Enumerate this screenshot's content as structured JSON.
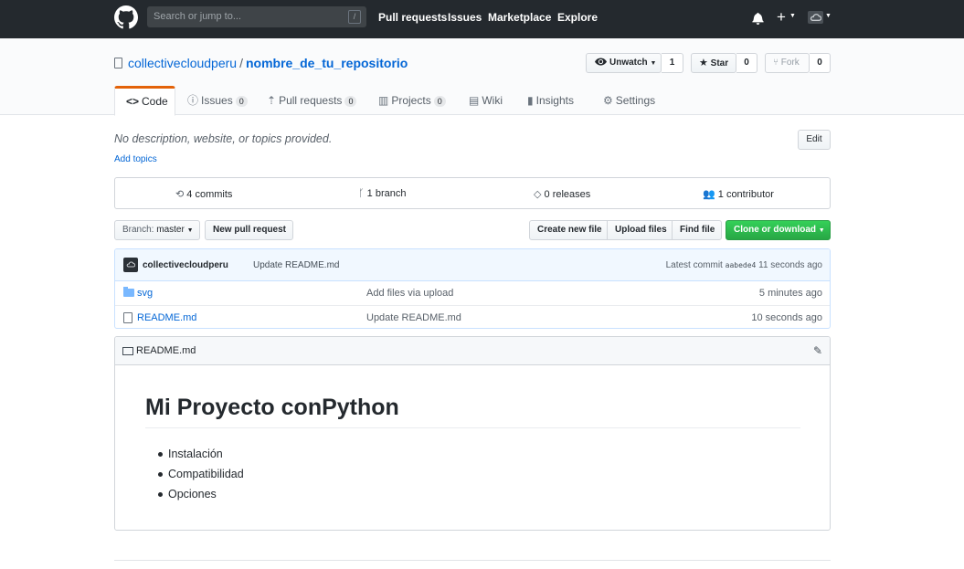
{
  "topbar": {
    "search_placeholder": "Search or jump to...",
    "search_shortcut": "/",
    "nav": [
      "Pull requests",
      "Issues",
      "Marketplace",
      "Explore"
    ]
  },
  "repo": {
    "owner": "collectivecloudperu",
    "separator": "/",
    "name": "nombre_de_tu_repositorio",
    "watch_label": "Unwatch",
    "watch_count": "1",
    "star_label": "Star",
    "star_count": "0",
    "fork_label": "Fork",
    "fork_count": "0"
  },
  "tabs": [
    {
      "label": "Code",
      "icon": "code-icon",
      "count": ""
    },
    {
      "label": "Issues",
      "icon": "issue-icon",
      "count": "0"
    },
    {
      "label": "Pull requests",
      "icon": "pull-request-icon",
      "count": "0"
    },
    {
      "label": "Projects",
      "icon": "project-icon",
      "count": "0"
    },
    {
      "label": "Wiki",
      "icon": "wiki-icon",
      "count": ""
    },
    {
      "label": "Insights",
      "icon": "graph-icon",
      "count": ""
    },
    {
      "label": "Settings",
      "icon": "gear-icon",
      "count": ""
    }
  ],
  "description": "No description, website, or topics provided.",
  "add_topics": "Add topics",
  "edit_label": "Edit",
  "stats": {
    "commits": "4 commits",
    "branches": "1 branch",
    "releases": "0 releases",
    "contributors": "1 contributor"
  },
  "toolbar": {
    "branch_prefix": "Branch:",
    "branch": "master",
    "new_pr": "New pull request",
    "create_file": "Create new file",
    "upload_files": "Upload files",
    "find_file": "Find file",
    "clone": "Clone or download"
  },
  "latest_commit": {
    "author": "collectivecloudperu",
    "message": "Update README.md",
    "prefix": "Latest commit",
    "sha": "aabede4",
    "age": "11 seconds ago"
  },
  "files": [
    {
      "name": "svg",
      "type": "folder",
      "message": "Add files via upload",
      "age": "5 minutes ago"
    },
    {
      "name": "README.md",
      "type": "file",
      "message": "Update README.md",
      "age": "10 seconds ago"
    }
  ],
  "readme": {
    "filename": "README.md",
    "heading": "Mi Proyecto conPython",
    "items": [
      "Instalación",
      "Compatibilidad",
      "Opciones"
    ]
  },
  "colors": {
    "topbar": "#24292e",
    "link": "#0366d6",
    "accent_tab": "#e36209",
    "clone_button": "#28a745"
  }
}
